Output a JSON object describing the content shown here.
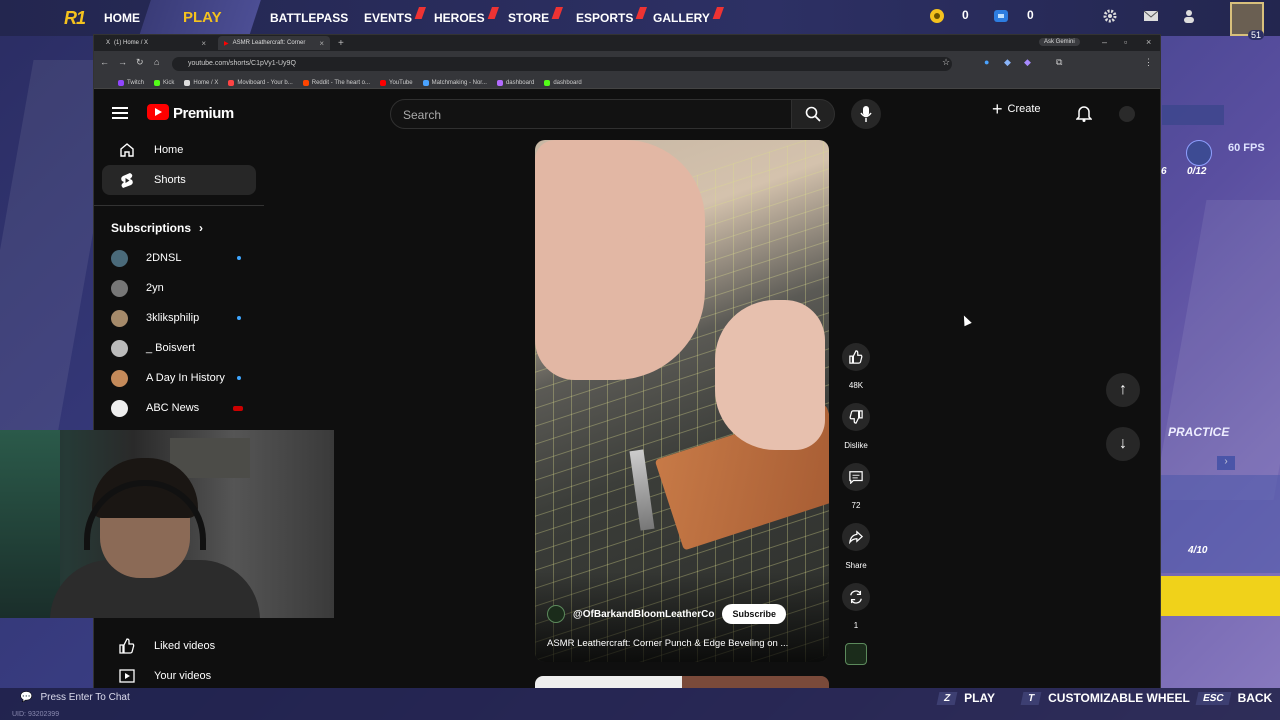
{
  "game": {
    "nav": [
      "HOME",
      "PLAY",
      "BATTLEPASS",
      "EVENTS",
      "HEROES",
      "STORE",
      "ESPORTS",
      "GALLERY"
    ],
    "currency1": "0",
    "currency2": "0",
    "level": "51",
    "fps": "60 FPS",
    "trophy_count": "0/12",
    "six": "6",
    "practice": "PRACTICE",
    "practice_count": "4/10",
    "chat_prompt": "Press Enter To Chat",
    "uid": "UID: 93202399",
    "hints": [
      {
        "key": "Z",
        "label": "PLAY"
      },
      {
        "key": "T",
        "label": "CUSTOMIZABLE WHEEL"
      },
      {
        "key": "ESC",
        "label": "BACK"
      }
    ]
  },
  "browser": {
    "tabs": [
      "(1) Home / X",
      "ASMR Leathercraft: Corner"
    ],
    "gemini": "Ask Gemini",
    "url": "youtube.com/shorts/C1pVy1-Uy9Q",
    "bookmarks": [
      "Twitch",
      "Kick",
      "Home / X",
      "Moviboard - Your b...",
      "Reddit - The heart o...",
      "YouTube",
      "Matchmaking - Nor...",
      "dashboard",
      "dashboard"
    ]
  },
  "youtube": {
    "brand": "Premium",
    "search_placeholder": "Search",
    "create": "Create",
    "sidebar": {
      "home": "Home",
      "shorts": "Shorts",
      "subscriptions": "Subscriptions",
      "subs": [
        {
          "name": "2DNSL",
          "dot": true
        },
        {
          "name": "2yn",
          "dot": false
        },
        {
          "name": "3kliksphilip",
          "dot": true
        },
        {
          "name": "_ Boisvert",
          "dot": false
        },
        {
          "name": "A Day In History",
          "dot": true
        },
        {
          "name": "ABC News",
          "dot": false
        }
      ],
      "liked": "Liked videos",
      "your_videos": "Your videos"
    },
    "short": {
      "channel": "@OfBarkandBloomLeatherCo",
      "subscribe": "Subscribe",
      "title": "ASMR Leathercraft: Corner Punch & Edge Beveling on ..."
    },
    "actions": {
      "likes": "48K",
      "dislike": "Dislike",
      "comments": "72",
      "share": "Share",
      "remix": "1"
    }
  },
  "colors": {
    "accent_yellow": "#f4c21e",
    "yt_red": "#ff0000",
    "live_red": "#cc0000",
    "dot_blue": "#3ea6ff"
  }
}
